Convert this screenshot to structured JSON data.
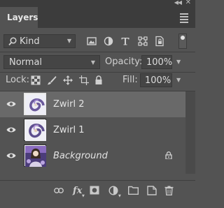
{
  "panel": {
    "title": "Layers",
    "colors": {
      "panel_bg": "#535353",
      "tab_strip": "#3c3c3c",
      "selected_row": "#696969",
      "text": "#d6d6d6"
    }
  },
  "filter": {
    "kind_label": "Kind",
    "icons": [
      "image-filter-icon",
      "adjustment-filter-icon",
      "type-filter-icon",
      "shape-filter-icon",
      "smart-object-filter-icon"
    ]
  },
  "blend": {
    "mode": "Normal",
    "opacity_label": "Opacity:",
    "opacity_value": "100%"
  },
  "lock": {
    "label": "Lock:",
    "icons": [
      "lock-transparent-pixels-icon",
      "lock-image-pixels-icon",
      "lock-position-icon",
      "lock-artboard-icon",
      "lock-all-icon"
    ],
    "fill_label": "Fill:",
    "fill_value": "100%"
  },
  "layers": [
    {
      "name": "Zwirl 2",
      "selected": true,
      "visible": true,
      "italic": false,
      "locked": false
    },
    {
      "name": "Zwirl 1",
      "selected": false,
      "visible": true,
      "italic": false,
      "locked": false
    },
    {
      "name": "Background",
      "selected": false,
      "visible": true,
      "italic": true,
      "locked": true
    }
  ],
  "bottom_toolbar": {
    "fx_label": "fx",
    "icons": [
      "link-layers-icon",
      "layer-style-icon",
      "add-mask-icon",
      "adjustment-layer-icon",
      "new-group-icon",
      "new-layer-icon",
      "delete-layer-icon"
    ]
  }
}
